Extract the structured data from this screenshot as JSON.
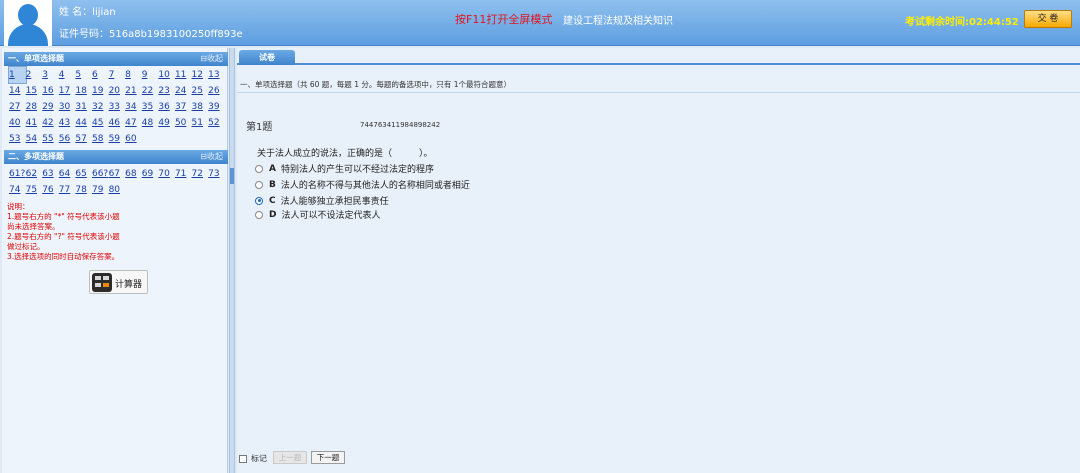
{
  "header": {
    "name": "姓 名：lijian",
    "id_number": "证件号码：516a8b1983100250ff893e",
    "fullscreen_tip": "按F11打开全屏模式",
    "exam_title": "建设工程法规及相关知识",
    "time_left": "考试剩余时间:02:44:52",
    "submit_label": "交 卷"
  },
  "left_panel": {
    "single_choice": {
      "title": "一、单项选择题",
      "collapse_label": "收起",
      "numbers": [
        "1",
        "2",
        "3",
        "4",
        "5",
        "6",
        "7",
        "8",
        "9",
        "10",
        "11",
        "12",
        "13",
        "14",
        "15",
        "16",
        "17",
        "18",
        "19",
        "20",
        "21",
        "22",
        "23",
        "24",
        "25",
        "26",
        "27",
        "28",
        "29",
        "30",
        "31",
        "32",
        "33",
        "34",
        "35",
        "36",
        "37",
        "38",
        "39",
        "40",
        "41",
        "42",
        "43",
        "44",
        "45",
        "46",
        "47",
        "48",
        "49",
        "50",
        "51",
        "52",
        "53",
        "54",
        "55",
        "56",
        "57",
        "58",
        "59",
        "60"
      ],
      "current": "1"
    },
    "multi_choice": {
      "title": "二、多项选择题",
      "collapse_label": "收起",
      "numbers": [
        "61?",
        "62",
        "63",
        "64",
        "65",
        "66?",
        "67",
        "68",
        "69",
        "70",
        "71",
        "72",
        "73",
        "74",
        "75",
        "76",
        "77",
        "78",
        "79",
        "80"
      ]
    },
    "notes": [
      "说明：",
      "1.题号右方的 \"*\" 符号代表该小题",
      "尚未选择答案。",
      "2.题号右方的 \"?\" 符号代表该小题",
      "做过标记。",
      "3.选择选项的同时自动保存答案。"
    ],
    "calculator_label": "计算器"
  },
  "main": {
    "tab_label": "试卷",
    "section_desc": "一、单项选择题（共 60 题，每题 1 分。每题的备选项中，只有 1个最符合题意）",
    "question": {
      "number_label": "第1题",
      "code": "744763411984898242",
      "stem": "关于法人成立的说法，正确的是（　　　）。",
      "options": [
        {
          "letter": "A",
          "text": "特别法人的产生可以不经过法定的程序",
          "checked": false
        },
        {
          "letter": "B",
          "text": "法人的名称不得与其他法人的名称相同或者相近",
          "checked": false
        },
        {
          "letter": "C",
          "text": "法人能够独立承担民事责任",
          "checked": true
        },
        {
          "letter": "D",
          "text": "法人可以不设法定代表人",
          "checked": false
        }
      ]
    },
    "mark_label": "标记",
    "prev_label": "上一题",
    "next_label": "下一题"
  }
}
